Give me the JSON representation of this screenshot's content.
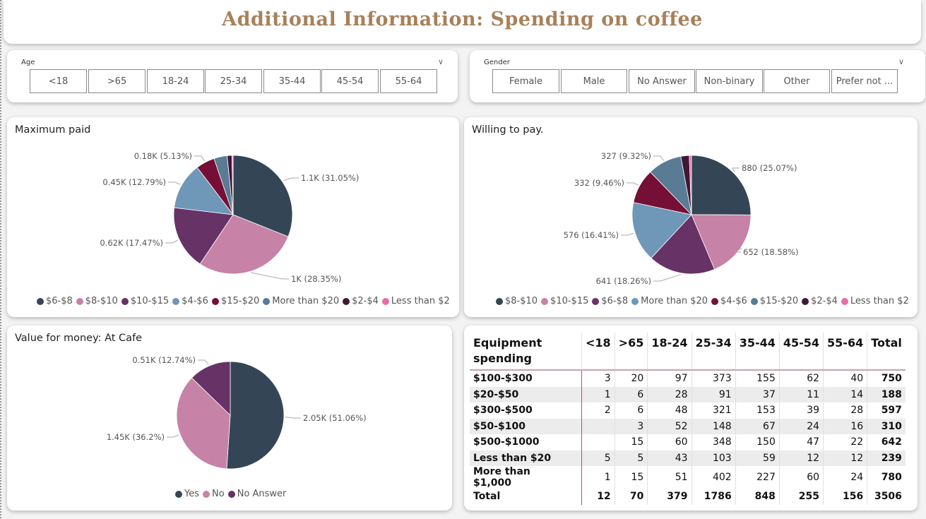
{
  "title": "Additional Information: Spending on coffee",
  "age_slicer": {
    "label": "Age",
    "options": [
      "<18",
      ">65",
      "18-24",
      "25-34",
      "35-44",
      "45-54",
      "55-64"
    ]
  },
  "gender_slicer": {
    "label": "Gender",
    "options": [
      "Female",
      "Male",
      "No Answer",
      "Non-binary",
      "Other",
      "Prefer not ..."
    ]
  },
  "chart_data": [
    {
      "type": "pie",
      "title": "Maximum paid",
      "slices": [
        {
          "name": "$6-$8",
          "percent": 31.05,
          "label": "1.1K (31.05%)",
          "color": "#344655"
        },
        {
          "name": "$8-$10",
          "percent": 28.35,
          "label": "1K (28.35%)",
          "color": "#c682a7"
        },
        {
          "name": "$10-$15",
          "percent": 17.47,
          "label": "0.62K (17.47%)",
          "color": "#673265"
        },
        {
          "name": "$4-$6",
          "percent": 12.79,
          "label": "0.45K (12.79%)",
          "color": "#6f97b7"
        },
        {
          "name": "$15-$20",
          "percent": 5.13,
          "label": "0.18K (5.13%)",
          "color": "#750f35"
        },
        {
          "name": "More than $20",
          "percent": 3.6,
          "label": "",
          "color": "#597b94"
        },
        {
          "name": "$2-$4",
          "percent": 1.3,
          "label": "",
          "color": "#3f1836"
        },
        {
          "name": "Less than $2",
          "percent": 0.31,
          "label": "",
          "color": "#e76da9"
        }
      ]
    },
    {
      "type": "pie",
      "title": "Willing to pay.",
      "slices": [
        {
          "name": "$8-$10",
          "value": 880,
          "percent": 25.07,
          "label": "880 (25.07%)",
          "color": "#344655"
        },
        {
          "name": "$10-$15",
          "value": 652,
          "percent": 18.58,
          "label": "652 (18.58%)",
          "color": "#c682a7"
        },
        {
          "name": "$6-$8",
          "value": 641,
          "percent": 18.26,
          "label": "641 (18.26%)",
          "color": "#673265"
        },
        {
          "name": "More than $20",
          "value": 576,
          "percent": 16.41,
          "label": "576 (16.41%)",
          "color": "#6f97b7"
        },
        {
          "name": "$4-$6",
          "value": 332,
          "percent": 9.46,
          "label": "332 (9.46%)",
          "color": "#750f35"
        },
        {
          "name": "$15-$20",
          "value": 327,
          "percent": 9.32,
          "label": "327 (9.32%)",
          "color": "#597b94"
        },
        {
          "name": "$2-$4",
          "percent": 2.3,
          "label": "",
          "color": "#3f1836"
        },
        {
          "name": "Less than $2",
          "percent": 0.6,
          "label": "",
          "color": "#e76da9"
        }
      ]
    },
    {
      "type": "pie",
      "title": "Value for money: At Cafe",
      "slices": [
        {
          "name": "Yes",
          "percent": 51.06,
          "label": "2.05K (51.06%)",
          "color": "#344655"
        },
        {
          "name": "No",
          "percent": 36.2,
          "label": "1.45K (36.2%)",
          "color": "#c682a7"
        },
        {
          "name": "No Answer",
          "percent": 12.74,
          "label": "0.51K (12.74%)",
          "color": "#673265"
        }
      ]
    },
    {
      "type": "table",
      "title": "Equipment spending",
      "columns": [
        "<18",
        ">65",
        "18-24",
        "25-34",
        "35-44",
        "45-54",
        "55-64",
        "Total"
      ],
      "rows": [
        {
          "label": "$100-$300",
          "values": [
            "3",
            "20",
            "97",
            "373",
            "155",
            "62",
            "40",
            "750"
          ]
        },
        {
          "label": "$20-$50",
          "values": [
            "1",
            "6",
            "28",
            "91",
            "37",
            "11",
            "14",
            "188"
          ]
        },
        {
          "label": "$300-$500",
          "values": [
            "2",
            "6",
            "48",
            "321",
            "153",
            "39",
            "28",
            "597"
          ]
        },
        {
          "label": "$50-$100",
          "values": [
            "",
            "3",
            "52",
            "148",
            "67",
            "24",
            "16",
            "310"
          ]
        },
        {
          "label": "$500-$1000",
          "values": [
            "",
            "15",
            "60",
            "348",
            "150",
            "47",
            "22",
            "642"
          ]
        },
        {
          "label": "Less than $20",
          "values": [
            "5",
            "5",
            "43",
            "103",
            "59",
            "12",
            "12",
            "239"
          ]
        },
        {
          "label": "More than $1,000",
          "values": [
            "1",
            "15",
            "51",
            "402",
            "227",
            "60",
            "24",
            "780"
          ]
        },
        {
          "label": "Total",
          "values": [
            "12",
            "70",
            "379",
            "1786",
            "848",
            "255",
            "156",
            "3506"
          ]
        }
      ]
    }
  ]
}
